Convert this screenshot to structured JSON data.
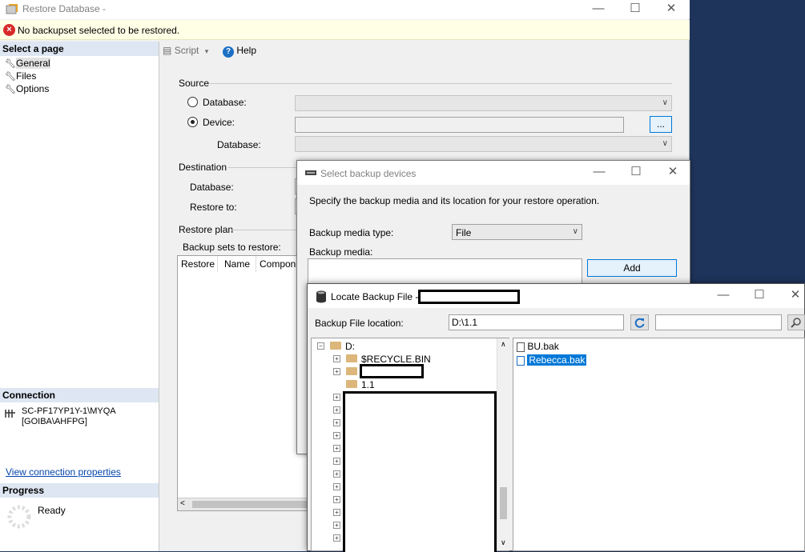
{
  "restore_window": {
    "title": "Restore Database -",
    "error_message": "No backupset selected to be restored.",
    "controls": {
      "minimize": "—",
      "maximize": "☐",
      "close": "✕"
    }
  },
  "left_pane": {
    "select_page_header": "Select a page",
    "pages": [
      {
        "label": "General",
        "selected": true
      },
      {
        "label": "Files",
        "selected": false
      },
      {
        "label": "Options",
        "selected": false
      }
    ],
    "connection_header": "Connection",
    "connection_server": "SC-PF17YP1Y-1\\MYQA",
    "connection_user": "[GOIBA\\AHFPG]",
    "view_connection_link": "View connection properties",
    "progress_header": "Progress",
    "progress_status": "Ready"
  },
  "toolbar": {
    "script_label": "Script",
    "help_label": "Help"
  },
  "general": {
    "source_label": "Source",
    "database_radio_label": "Database:",
    "device_radio_label": "Device:",
    "selected_source": "Device",
    "device_database_label": "Database:",
    "browse_button_label": "...",
    "destination_label": "Destination",
    "dest_database_label": "Database:",
    "restore_to_label": "Restore to:",
    "restore_plan_label": "Restore plan",
    "backup_sets_label": "Backup sets to restore:",
    "grid_columns": [
      "Restore",
      "Name",
      "Componen"
    ]
  },
  "select_devices_dialog": {
    "title": "Select backup devices",
    "instruction": "Specify the backup media and its location for your restore operation.",
    "media_type_label": "Backup media type:",
    "media_type_value": "File",
    "media_label": "Backup media:",
    "add_button_label": "Add",
    "controls": {
      "minimize": "—",
      "maximize": "☐",
      "close": "✕"
    }
  },
  "locate_dialog": {
    "title": "Locate Backup File -",
    "location_label": "Backup File location:",
    "location_value": "D:\\1.1",
    "search_value": "",
    "controls": {
      "minimize": "—",
      "maximize": "☐",
      "close": "✕"
    },
    "tree": {
      "root": "D:",
      "children": [
        "$RECYCLE.BIN",
        "",
        "1.1"
      ]
    },
    "files": [
      {
        "name": "BU.bak",
        "selected": false
      },
      {
        "name": "Rebecca.bak",
        "selected": true
      }
    ]
  }
}
